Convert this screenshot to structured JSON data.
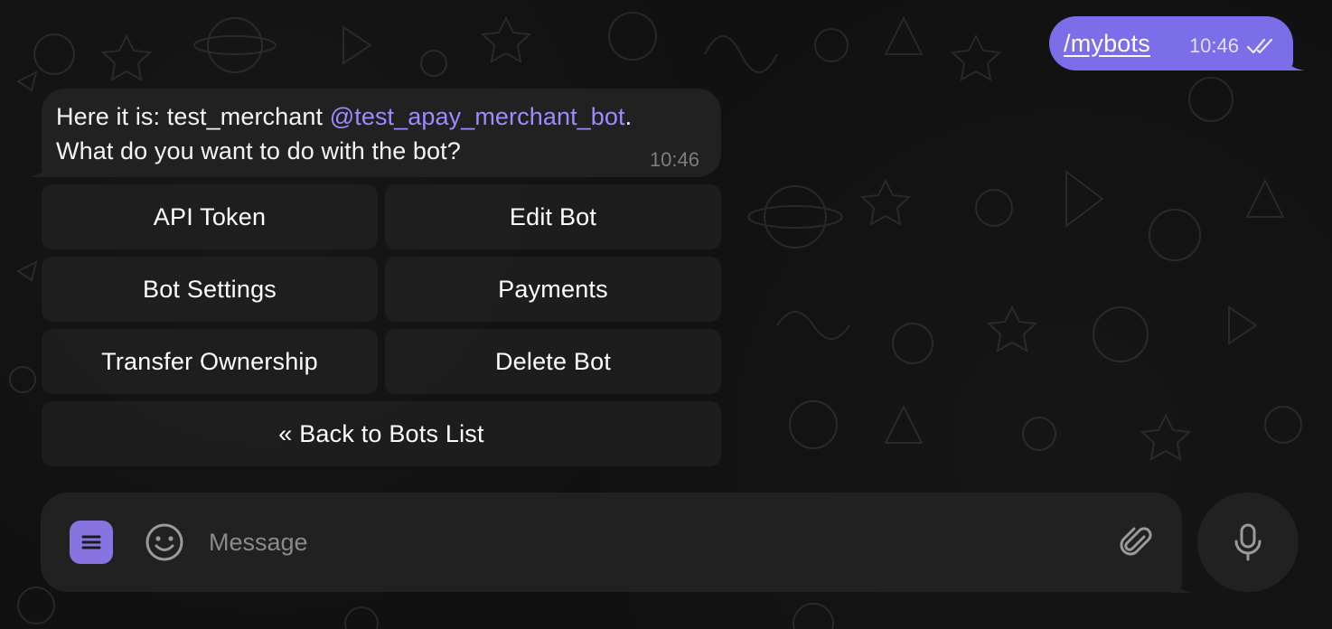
{
  "outgoing": {
    "text": "/mybots",
    "time": "10:46",
    "status_icon": "double-check-icon"
  },
  "incoming": {
    "prefix": "Here it is: test_merchant ",
    "mention": "@test_apay_merchant_bot",
    "suffix": ".",
    "line2": "What do you want to do with the bot?",
    "time": "10:46"
  },
  "keyboard": {
    "rows": [
      [
        "API Token",
        "Edit Bot"
      ],
      [
        "Bot Settings",
        "Payments"
      ],
      [
        "Transfer Ownership",
        "Delete Bot"
      ],
      [
        "« Back to Bots List"
      ]
    ]
  },
  "composer": {
    "placeholder": "Message",
    "menu_icon": "menu-icon",
    "emoji_icon": "smiley-icon",
    "attach_icon": "paperclip-icon",
    "mic_icon": "microphone-icon"
  },
  "colors": {
    "accent": "#8774e1",
    "outgoing_bubble": "#7b6ee8",
    "incoming_bubble": "#212121",
    "mention": "#9b8cff",
    "background": "#111111"
  }
}
